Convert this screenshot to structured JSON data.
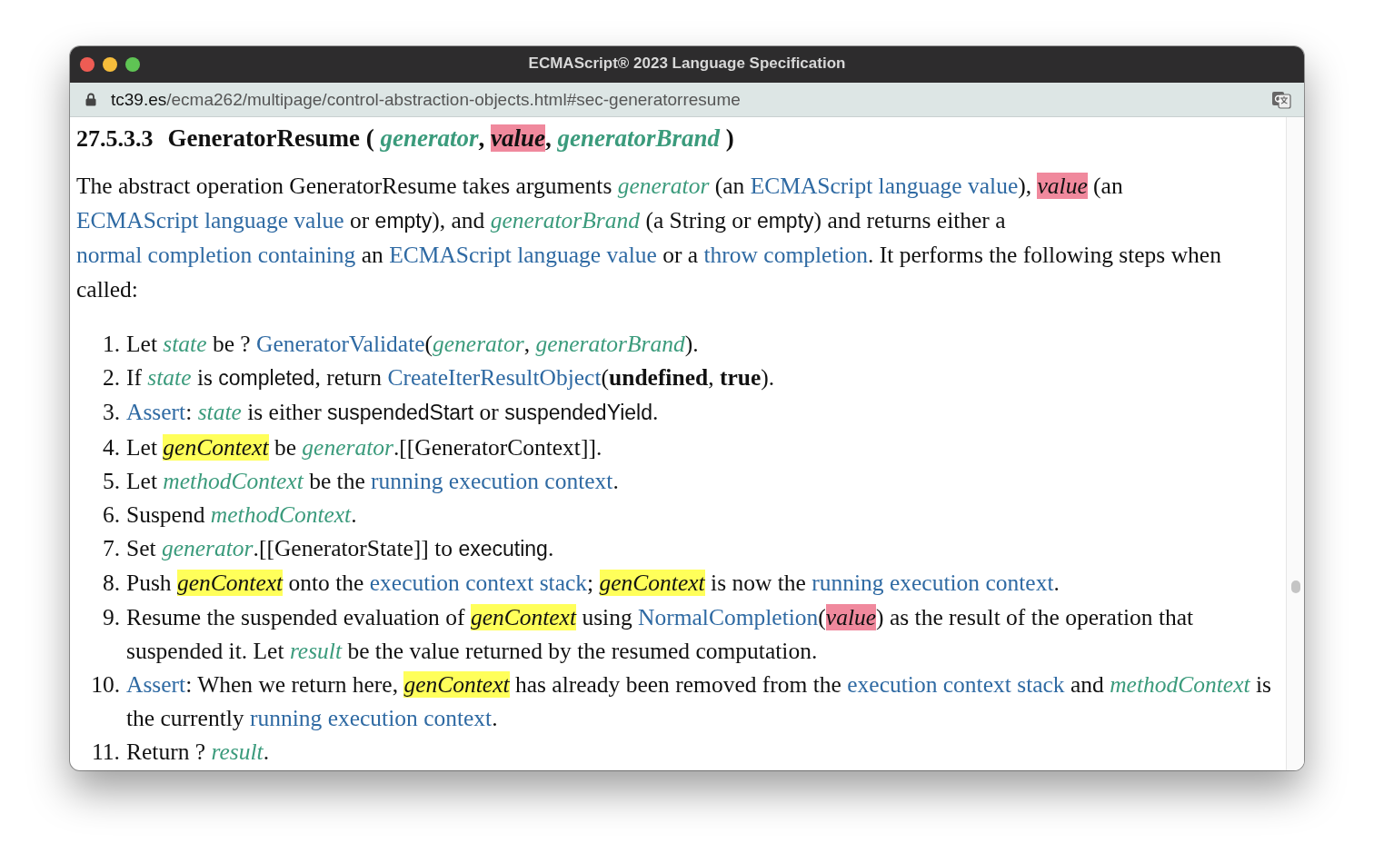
{
  "window": {
    "title": "ECMAScript® 2023 Language Specification"
  },
  "address_bar": {
    "host": "tc39.es",
    "path": "/ecma262/multipage/control-abstraction-objects.html#sec-generatorresume"
  },
  "heading": {
    "number": "27.5.3.3",
    "segments": [
      {
        "kind": "text",
        "text": "GeneratorResume ( "
      },
      {
        "kind": "var",
        "text": "generator"
      },
      {
        "kind": "text",
        "text": ", "
      },
      {
        "kind": "var",
        "text": "value",
        "color": "#f0899d"
      },
      {
        "kind": "text",
        "text": ", "
      },
      {
        "kind": "var",
        "text": "generatorBrand"
      },
      {
        "kind": "text",
        "text": " )"
      }
    ]
  },
  "intro": {
    "segments": [
      {
        "kind": "text",
        "text": "The abstract operation GeneratorResume takes arguments "
      },
      {
        "kind": "var",
        "text": "generator"
      },
      {
        "kind": "text",
        "text": " (an "
      },
      {
        "kind": "link",
        "text": "ECMAScript language value"
      },
      {
        "kind": "text",
        "text": "), "
      },
      {
        "kind": "var",
        "text": "value",
        "color": "#f0899d"
      },
      {
        "kind": "text",
        "text": " (an "
      },
      {
        "kind": "link",
        "text": "ECMAScript language value"
      },
      {
        "kind": "text",
        "text": " or "
      },
      {
        "kind": "value",
        "text": "empty"
      },
      {
        "kind": "text",
        "text": "), and "
      },
      {
        "kind": "var",
        "text": "generatorBrand"
      },
      {
        "kind": "text",
        "text": " (a String or "
      },
      {
        "kind": "value",
        "text": "empty"
      },
      {
        "kind": "text",
        "text": ") and returns either a "
      },
      {
        "kind": "link",
        "text": "normal completion containing"
      },
      {
        "kind": "text",
        "text": " an "
      },
      {
        "kind": "link",
        "text": "ECMAScript language value"
      },
      {
        "kind": "text",
        "text": " or a "
      },
      {
        "kind": "link",
        "text": "throw completion"
      },
      {
        "kind": "text",
        "text": ". It performs the following steps when called:"
      }
    ]
  },
  "steps": [
    {
      "number": "1.",
      "segments": [
        {
          "kind": "text",
          "text": "Let "
        },
        {
          "kind": "var",
          "text": "state"
        },
        {
          "kind": "text",
          "text": " be ? "
        },
        {
          "kind": "link",
          "text": "GeneratorValidate"
        },
        {
          "kind": "text",
          "text": "("
        },
        {
          "kind": "var",
          "text": "generator"
        },
        {
          "kind": "text",
          "text": ", "
        },
        {
          "kind": "var",
          "text": "generatorBrand"
        },
        {
          "kind": "text",
          "text": ")."
        }
      ]
    },
    {
      "number": "2.",
      "segments": [
        {
          "kind": "text",
          "text": "If "
        },
        {
          "kind": "var",
          "text": "state"
        },
        {
          "kind": "text",
          "text": " is "
        },
        {
          "kind": "value",
          "text": "completed"
        },
        {
          "kind": "text",
          "text": ", return "
        },
        {
          "kind": "link",
          "text": "CreateIterResultObject"
        },
        {
          "kind": "text",
          "text": "("
        },
        {
          "kind": "bold",
          "text": "undefined"
        },
        {
          "kind": "text",
          "text": ", "
        },
        {
          "kind": "bold",
          "text": "true"
        },
        {
          "kind": "text",
          "text": ")."
        }
      ]
    },
    {
      "number": "3.",
      "segments": [
        {
          "kind": "link",
          "text": "Assert"
        },
        {
          "kind": "text",
          "text": ": "
        },
        {
          "kind": "var",
          "text": "state"
        },
        {
          "kind": "text",
          "text": " is either "
        },
        {
          "kind": "value",
          "text": "suspendedStart"
        },
        {
          "kind": "text",
          "text": " or "
        },
        {
          "kind": "value",
          "text": "suspendedYield"
        },
        {
          "kind": "text",
          "text": "."
        }
      ]
    },
    {
      "number": "4.",
      "segments": [
        {
          "kind": "text",
          "text": "Let "
        },
        {
          "kind": "var",
          "text": "genContext",
          "color": "#ffff5a"
        },
        {
          "kind": "text",
          "text": " be "
        },
        {
          "kind": "var",
          "text": "generator"
        },
        {
          "kind": "text",
          "text": ".[[GeneratorContext]]."
        }
      ]
    },
    {
      "number": "5.",
      "segments": [
        {
          "kind": "text",
          "text": "Let "
        },
        {
          "kind": "var",
          "text": "methodContext"
        },
        {
          "kind": "text",
          "text": " be the "
        },
        {
          "kind": "link",
          "text": "running execution context"
        },
        {
          "kind": "text",
          "text": "."
        }
      ]
    },
    {
      "number": "6.",
      "segments": [
        {
          "kind": "text",
          "text": "Suspend "
        },
        {
          "kind": "var",
          "text": "methodContext"
        },
        {
          "kind": "text",
          "text": "."
        }
      ]
    },
    {
      "number": "7.",
      "segments": [
        {
          "kind": "text",
          "text": "Set "
        },
        {
          "kind": "var",
          "text": "generator"
        },
        {
          "kind": "text",
          "text": ".[[GeneratorState]] to "
        },
        {
          "kind": "value",
          "text": "executing"
        },
        {
          "kind": "text",
          "text": "."
        }
      ]
    },
    {
      "number": "8.",
      "segments": [
        {
          "kind": "text",
          "text": "Push "
        },
        {
          "kind": "var",
          "text": "genContext",
          "color": "#ffff5a"
        },
        {
          "kind": "text",
          "text": " onto the "
        },
        {
          "kind": "link",
          "text": "execution context stack"
        },
        {
          "kind": "text",
          "text": "; "
        },
        {
          "kind": "var",
          "text": "genContext",
          "color": "#ffff5a"
        },
        {
          "kind": "text",
          "text": " is now the "
        },
        {
          "kind": "link",
          "text": "running execution context"
        },
        {
          "kind": "text",
          "text": "."
        }
      ]
    },
    {
      "number": "9.",
      "segments": [
        {
          "kind": "text",
          "text": "Resume the suspended evaluation of "
        },
        {
          "kind": "var",
          "text": "genContext",
          "color": "#ffff5a"
        },
        {
          "kind": "text",
          "text": " using "
        },
        {
          "kind": "link",
          "text": "NormalCompletion"
        },
        {
          "kind": "text",
          "text": "("
        },
        {
          "kind": "var",
          "text": "value",
          "color": "#f0899d"
        },
        {
          "kind": "text",
          "text": ") as the result of the operation that suspended it. Let "
        },
        {
          "kind": "var",
          "text": "result"
        },
        {
          "kind": "text",
          "text": " be the value returned by the resumed computation."
        }
      ]
    },
    {
      "number": "10.",
      "segments": [
        {
          "kind": "link",
          "text": "Assert"
        },
        {
          "kind": "text",
          "text": ": When we return here, "
        },
        {
          "kind": "var",
          "text": "genContext",
          "color": "#ffff5a"
        },
        {
          "kind": "text",
          "text": " has already been removed from the "
        },
        {
          "kind": "link",
          "text": "execution context stack"
        },
        {
          "kind": "text",
          "text": " and "
        },
        {
          "kind": "var",
          "text": "methodContext"
        },
        {
          "kind": "text",
          "text": " is the currently "
        },
        {
          "kind": "link",
          "text": "running execution context"
        },
        {
          "kind": "text",
          "text": "."
        }
      ]
    },
    {
      "number": "11.",
      "segments": [
        {
          "kind": "text",
          "text": "Return ? "
        },
        {
          "kind": "var",
          "text": "result"
        },
        {
          "kind": "text",
          "text": "."
        }
      ]
    }
  ]
}
